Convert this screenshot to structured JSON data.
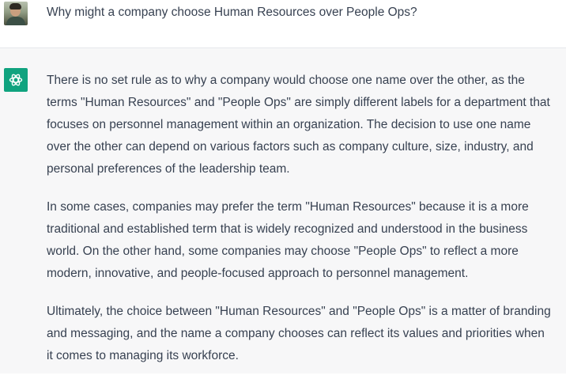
{
  "conversation": {
    "user": {
      "avatar": "user-avatar-photo",
      "message": "Why might a company choose Human Resources over People Ops?"
    },
    "assistant": {
      "icon": "openai-logo-icon",
      "accent_color": "#10a37f",
      "paragraphs": [
        "There is no set rule as to why a company would choose one name over the other, as the terms \"Human Resources\" and \"People Ops\" are simply different labels for a department that focuses on personnel management within an organization. The decision to use one name over the other can depend on various factors such as company culture, size, industry, and personal preferences of the leadership team.",
        "In some cases, companies may prefer the term \"Human Resources\" because it is a more traditional and established term that is widely recognized and understood in the business world. On the other hand, some companies may choose \"People Ops\" to reflect a more modern, innovative, and people-focused approach to personnel management.",
        "Ultimately, the choice between \"Human Resources\" and \"People Ops\" is a matter of branding and messaging, and the name a company chooses can reflect its values and priorities when it comes to managing its workforce."
      ]
    }
  }
}
